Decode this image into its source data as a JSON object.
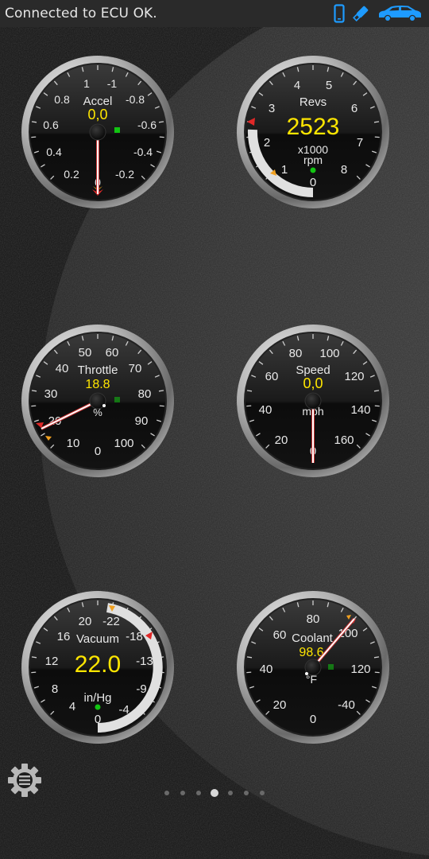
{
  "status_bar": {
    "text": "Connected to ECU OK.",
    "icons": [
      "phone-icon",
      "bluetooth-adapter-icon",
      "car-icon"
    ],
    "icon_color": "#1e9bff"
  },
  "colors": {
    "value_yellow": "#ffe600",
    "label_white": "#e8e8e8",
    "needle": "#ffffff",
    "needle_edge": "#c63030",
    "warn_orange": "#f0a020",
    "warn_red": "#e02828",
    "indicator_green": "#12c412"
  },
  "gauges": [
    {
      "id": "accel",
      "label": "Accel",
      "value": "0,0",
      "unit": "",
      "ticks": [
        "1",
        "-1",
        "0.8",
        "-0.8",
        "0.6",
        "-0.6",
        "0.4",
        "-0.4",
        "0.2",
        "-0.2",
        "0"
      ],
      "needle_value": 0.0,
      "green_square": true
    },
    {
      "id": "revs",
      "label": "Revs",
      "value": "2523",
      "unit_line1": "x1000",
      "unit_line2": "rpm",
      "ticks": [
        "0",
        "1",
        "2",
        "3",
        "4",
        "5",
        "6",
        "7",
        "8"
      ],
      "needle_value": 2.523,
      "green_dot": true,
      "arc": true
    },
    {
      "id": "throttle",
      "label": "Throttle",
      "value": "18.8",
      "unit": "%",
      "ticks": [
        "0",
        "10",
        "20",
        "30",
        "40",
        "50",
        "60",
        "70",
        "80",
        "90",
        "100"
      ],
      "needle_value": 18.8,
      "green_square": true
    },
    {
      "id": "speed",
      "label": "Speed",
      "value": "0,0",
      "unit": "mph",
      "ticks": [
        "0",
        "20",
        "40",
        "60",
        "80",
        "100",
        "120",
        "140",
        "160"
      ],
      "needle_value": 0.0
    },
    {
      "id": "vacuum",
      "label": "Vacuum",
      "value": "22.0",
      "unit": "in/Hg",
      "ticks": [
        "4",
        "8",
        "12",
        "16",
        "20",
        "-22",
        "-18",
        "-13",
        "-9",
        "-4",
        "0"
      ],
      "needle_value": 22.0,
      "green_dot": true,
      "arc": true
    },
    {
      "id": "coolant",
      "label": "Coolant",
      "value": "98.6",
      "unit": "°F",
      "ticks": [
        "0",
        "20",
        "40",
        "60",
        "80",
        "100",
        "120",
        "-40"
      ],
      "needle_value": 98.6,
      "green_square": true
    }
  ],
  "page_indicator": {
    "count": 7,
    "active_index": 3
  },
  "settings": {
    "icon": "gear-menu-icon"
  }
}
